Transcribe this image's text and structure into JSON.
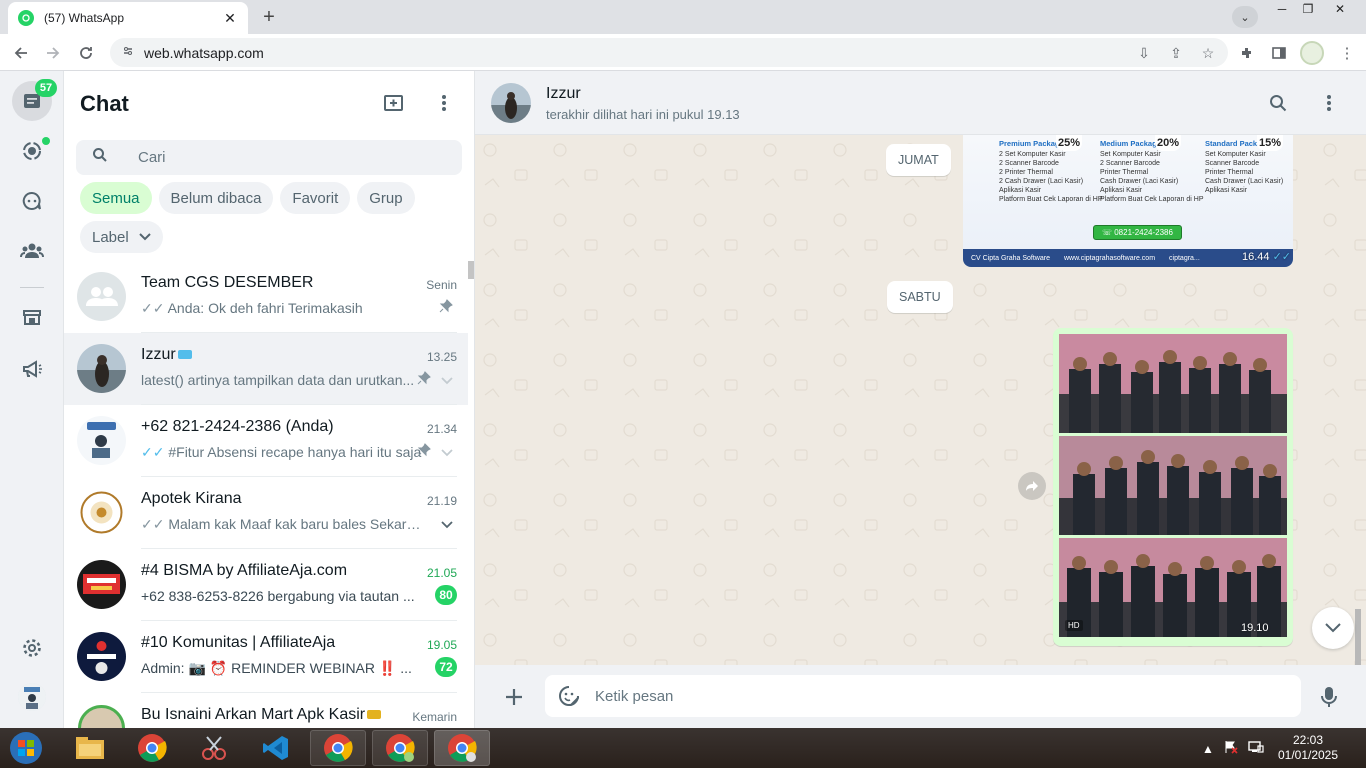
{
  "browser": {
    "tab_title": "(57) WhatsApp",
    "tab_close": "✕",
    "new_tab": "+",
    "url": "web.whatsapp.com"
  },
  "rail": {
    "unread_count": "57"
  },
  "sidebar": {
    "title": "Chat",
    "search_placeholder": "Cari",
    "filters": [
      "Semua",
      "Belum dibaca",
      "Favorit",
      "Grup"
    ],
    "label_chip": "Label",
    "chats": [
      {
        "name": "Team CGS DESEMBER",
        "time": "Senin",
        "preview": "Anda: Ok deh fahri Terimakasih",
        "ticks": "✓✓",
        "pinned": true,
        "unread": ""
      },
      {
        "name": "Izzur",
        "time": "13.25",
        "preview": "latest()   artinya tampilkan data dan urutkan...",
        "ticks": "",
        "pinned": true,
        "unread": ""
      },
      {
        "name": "+62 821-2424-2386 (Anda)",
        "time": "21.34",
        "preview": "#Fitur Absensi recape hanya hari itu saja",
        "ticks": "✓✓",
        "pinned": true,
        "unread": ""
      },
      {
        "name": "Apotek Kirana",
        "time": "21.19",
        "preview": "Malam kak Maaf kak baru bales Sekaran...",
        "ticks": "✓✓",
        "pinned": false,
        "unread": ""
      },
      {
        "name": "#4 BISMA by AffiliateAja.com",
        "time": "21.05",
        "preview": "+62 838-6253-8226 bergabung via tautan ...",
        "ticks": "",
        "pinned": false,
        "unread": "80"
      },
      {
        "name": "#10 Komunitas | AffiliateAja",
        "time": "19.05",
        "preview": "Admin: 📷 ⏰ REMINDER WEBINAR ‼️ ...",
        "ticks": "",
        "pinned": false,
        "unread": "72"
      },
      {
        "name": "Bu Isnaini Arkan Mart Apk Kasir",
        "time": "Kemarin",
        "preview": "",
        "ticks": "",
        "pinned": false,
        "unread": ""
      }
    ]
  },
  "conversation": {
    "name": "Izzur",
    "status": "terakhir dilihat hari ini pukul 19.13",
    "date_chips": [
      "JUMAT",
      "SABTU"
    ],
    "promo": {
      "packages": [
        {
          "title": "Premium Package",
          "discount": "25%",
          "items": [
            "2 Set Komputer Kasir",
            "2 Scanner Barcode",
            "2 Printer Thermal",
            "2 Cash Drawer (Laci Kasir)",
            "Aplikasi Kasir",
            "Platform Buat Cek Laporan di HP"
          ]
        },
        {
          "title": "Medium Package",
          "discount": "20%",
          "items": [
            "Set Komputer Kasir",
            "2 Scanner Barcode",
            "Printer Thermal",
            "Cash Drawer (Laci Kasir)",
            "Aplikasi Kasir",
            "Platform Buat Cek Laporan di HP"
          ]
        },
        {
          "title": "Standard Package",
          "discount": "15%",
          "items": [
            "Set Komputer Kasir",
            "Scanner Barcode",
            "Printer Thermal",
            "Cash Drawer (Laci Kasir)",
            "Aplikasi Kasir"
          ]
        }
      ],
      "phone": "0821-2424-2386",
      "footer": [
        "CV Cipta Graha Software",
        "www.ciptagrahasoftware.com",
        "ciptagra..."
      ],
      "time": "16.44"
    },
    "album": {
      "time": "19.10",
      "hd": "HD"
    },
    "composer_placeholder": "Ketik pesan"
  },
  "taskbar": {
    "time": "22:03",
    "date": "01/01/2025"
  },
  "colors": {
    "accent": "#25d366",
    "selected_chip_bg": "#d9fdd3",
    "chat_bg": "#efeae2"
  }
}
